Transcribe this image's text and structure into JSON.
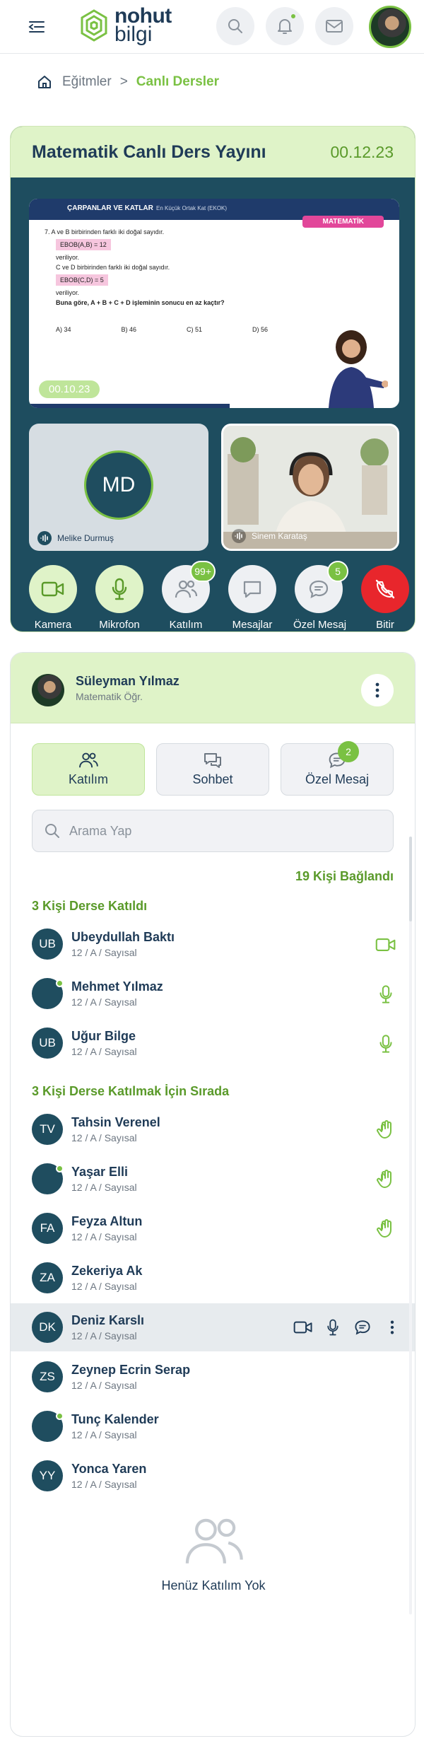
{
  "header": {
    "logo_line1": "nohut",
    "logo_line2": "bilgi"
  },
  "breadcrumb": {
    "home_icon": "home-icon",
    "items": [
      "Eğitmler",
      "Canlı Dersler"
    ],
    "separator": ">"
  },
  "live": {
    "title": "Matematik Canlı Ders Yayını",
    "date": "00.12.23",
    "slide": {
      "header_title": "ÇARPANLAR VE KATLAR",
      "header_sub": "En Küçük Ortak Kat (EKOK)",
      "subject": "MATEMATİK",
      "question_no": "7.",
      "line1": "A ve B birbirinden farklı iki doğal sayıdır.",
      "box1": "EBOB(A,B) = 12",
      "line2": "veriliyor.",
      "line3": "C ve D birbirinden farklı iki doğal sayıdır.",
      "box2": "EBOB(C,D) = 5",
      "line4": "veriliyor.",
      "line5": "Buna göre, A + B + C + D işleminin sonucu en az kaçtır?",
      "options": [
        "A) 34",
        "B) 46",
        "C) 51",
        "D) 56"
      ],
      "time": "00.10.23"
    },
    "tiles": [
      {
        "initials": "MD",
        "name": "Melike Durmuş"
      },
      {
        "name": "Sinem Karataş"
      }
    ],
    "controls": [
      {
        "label": "Kamera",
        "icon": "video-icon"
      },
      {
        "label": "Mikrofon",
        "icon": "microphone-icon"
      },
      {
        "label": "Katılım",
        "icon": "users-icon",
        "badge": "99+"
      },
      {
        "label": "Mesajlar",
        "icon": "message-icon"
      },
      {
        "label": "Özel Mesaj",
        "icon": "chat-bubble-icon",
        "badge": "5"
      },
      {
        "label": "Bitir",
        "icon": "end-call-icon"
      }
    ]
  },
  "participants": {
    "teacher": {
      "name": "Süleyman Yılmaz",
      "role": "Matematik Öğr."
    },
    "tabs": [
      {
        "label": "Katılım",
        "icon": "users-icon"
      },
      {
        "label": "Sohbet",
        "icon": "chat-icon"
      },
      {
        "label": "Özel Mesaj",
        "icon": "chat-bubble-icon",
        "badge": "2"
      }
    ],
    "search_placeholder": "Arama Yap",
    "connected": "19 Kişi Bağlandı",
    "joined_title": "3 Kişi Derse Katıldı",
    "joined": [
      {
        "initials": "UB",
        "name": "Ubeydullah Baktı",
        "class": "12 / A / Sayısal",
        "action": "video-icon"
      },
      {
        "initials": "",
        "name": "Mehmet Yılmaz",
        "class": "12 / A / Sayısal",
        "action": "microphone-icon"
      },
      {
        "initials": "UB",
        "name": "Uğur Bilge",
        "class": "12 / A / Sayısal",
        "action": "microphone-icon"
      }
    ],
    "queue_title": "3 Kişi Derse Katılmak İçin Sırada",
    "queue": [
      {
        "initials": "TV",
        "name": "Tahsin Verenel",
        "class": "12 / A / Sayısal",
        "action": "raised-hand-icon"
      },
      {
        "initials": "",
        "name": "Yaşar Elli",
        "class": "12 / A / Sayısal",
        "action": "raised-hand-icon"
      },
      {
        "initials": "FA",
        "name": "Feyza Altun",
        "class": "12 / A / Sayısal",
        "action": "raised-hand-icon"
      },
      {
        "initials": "ZA",
        "name": "Zekeriya Ak",
        "class": "12 / A / Sayısal"
      },
      {
        "initials": "DK",
        "name": "Deniz Karslı",
        "class": "12 / A / Sayısal"
      },
      {
        "initials": "ZS",
        "name": "Zeynep Ecrin Serap",
        "class": "12 / A / Sayısal"
      },
      {
        "initials": "",
        "name": "Tunç Kalender",
        "class": "12 / A / Sayısal"
      },
      {
        "initials": "YY",
        "name": "Yonca Yaren",
        "class": "12 / A / Sayısal"
      }
    ],
    "empty_label": "Henüz Katılım Yok"
  },
  "colors": {
    "brand_green": "#7ac143",
    "dark_teal": "#1e4d5f",
    "light_green": "#dff3c8",
    "danger_red": "#e8262c"
  }
}
